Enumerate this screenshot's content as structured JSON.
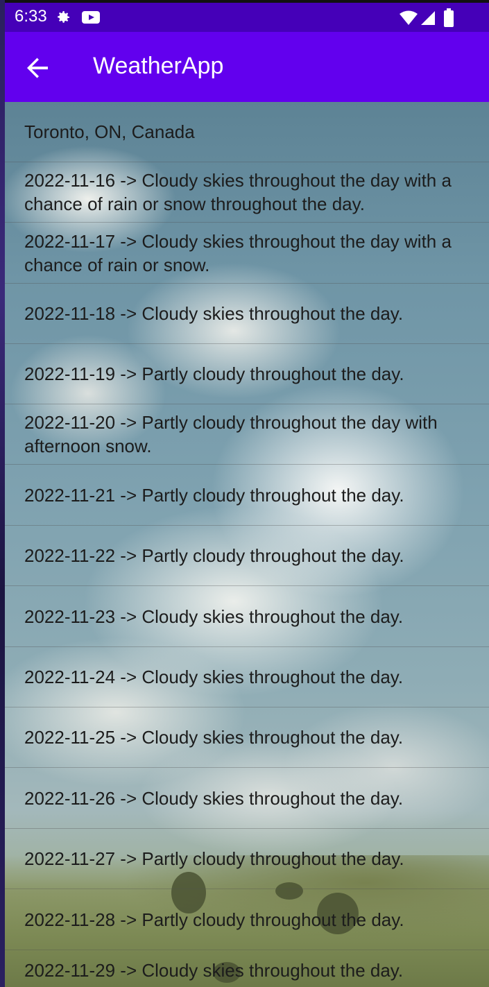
{
  "status_bar": {
    "time": "6:33",
    "icons": [
      "gear-icon",
      "youtube-icon",
      "wifi-icon",
      "signal-icon",
      "battery-icon"
    ]
  },
  "app_bar": {
    "title": "WeatherApp",
    "back_icon": "arrow-left-icon"
  },
  "location": "Toronto, ON, Canada",
  "forecast": [
    "2022-11-16 ->  Cloudy skies throughout the day with a chance of rain or snow throughout the day.",
    "2022-11-17 ->  Cloudy skies throughout the day with a chance of rain or snow.",
    "2022-11-18 ->  Cloudy skies throughout the day.",
    "2022-11-19 ->  Partly cloudy throughout the day.",
    "2022-11-20 ->  Partly cloudy throughout the day with afternoon snow.",
    "2022-11-21 ->  Partly cloudy throughout the day.",
    "2022-11-22 ->  Partly cloudy throughout the day.",
    "2022-11-23 ->  Cloudy skies throughout the day.",
    "2022-11-24 ->  Cloudy skies throughout the day.",
    "2022-11-25 ->  Cloudy skies throughout the day.",
    "2022-11-26 ->  Cloudy skies throughout the day.",
    "2022-11-27 ->  Partly cloudy throughout the day.",
    "2022-11-28 ->  Partly cloudy throughout the day.",
    "2022-11-29 ->  Cloudy skies throughout the day."
  ],
  "colors": {
    "status_bar": "#4500b8",
    "app_bar": "#6200ee"
  }
}
